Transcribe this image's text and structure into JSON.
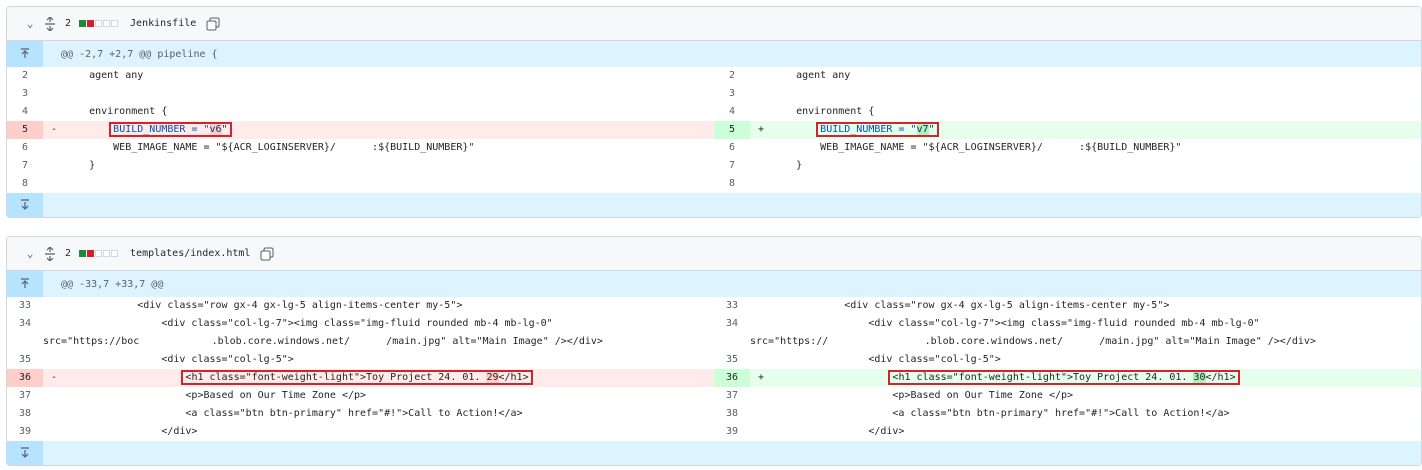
{
  "files": [
    {
      "count": "2",
      "name": "Jenkinsfile",
      "hunk": "@@ -2,7 +2,7 @@ pipeline {",
      "left": {
        "l1": {
          "n": "2",
          "t": "    agent any"
        },
        "l2": {
          "n": "3",
          "t": ""
        },
        "l3": {
          "n": "4",
          "t": "    environment {"
        },
        "l4": {
          "n": "5",
          "m": "-",
          "pre": "        ",
          "a": "BUILD_NUMBER = \"",
          "hi": "v6",
          "b": "\""
        },
        "l5": {
          "n": "6",
          "t": "        WEB_IMAGE_NAME = \"${ACR_LOGINSERVER}/      :${BUILD_NUMBER}\""
        },
        "l6": {
          "n": "7",
          "t": "    }"
        },
        "l7": {
          "n": "8",
          "t": ""
        }
      },
      "right": {
        "l1": {
          "n": "2",
          "t": "    agent any"
        },
        "l2": {
          "n": "3",
          "t": ""
        },
        "l3": {
          "n": "4",
          "t": "    environment {"
        },
        "l4": {
          "n": "5",
          "m": "+",
          "pre": "        ",
          "a": "BUILD_NUMBER = \"",
          "hi": "v7",
          "b": "\""
        },
        "l5": {
          "n": "6",
          "t": "        WEB_IMAGE_NAME = \"${ACR_LOGINSERVER}/      :${BUILD_NUMBER}\""
        },
        "l6": {
          "n": "7",
          "t": "    }"
        },
        "l7": {
          "n": "8",
          "t": ""
        }
      }
    },
    {
      "count": "2",
      "name": "templates/index.html",
      "hunk": "@@ -33,7 +33,7 @@",
      "left": {
        "l1": {
          "n": "33",
          "t": "            <div class=\"row gx-4 gx-lg-5 align-items-center my-5\">"
        },
        "l2": {
          "n": "34",
          "t": "                <div class=\"col-lg-7\"><img class=\"img-fluid rounded mb-4 mb-lg-0\""
        },
        "l2b": {
          "t": "src=\"https://boc            .blob.core.windows.net/      /main.jpg\" alt=\"Main Image\" /></div>"
        },
        "l3": {
          "n": "35",
          "t": "                <div class=\"col-lg-5\">"
        },
        "l4": {
          "n": "36",
          "m": "-",
          "pre": "                    ",
          "a": "<h1 class=\"font-weight-light\">Toy Project 24. 01. ",
          "hi": "29",
          "b": "</h1>"
        },
        "l5": {
          "n": "37",
          "t": "                    <p>Based on Our Time Zone </p>"
        },
        "l6": {
          "n": "38",
          "t": "                    <a class=\"btn btn-primary\" href=\"#!\">Call to Action!</a>"
        },
        "l7": {
          "n": "39",
          "t": "                </div>"
        }
      },
      "right": {
        "l1": {
          "n": "33",
          "t": "            <div class=\"row gx-4 gx-lg-5 align-items-center my-5\">"
        },
        "l2": {
          "n": "34",
          "t": "                <div class=\"col-lg-7\"><img class=\"img-fluid rounded mb-4 mb-lg-0\""
        },
        "l2b": {
          "t": "src=\"https://                .blob.core.windows.net/      /main.jpg\" alt=\"Main Image\" /></div>"
        },
        "l3": {
          "n": "35",
          "t": "                <div class=\"col-lg-5\">"
        },
        "l4": {
          "n": "36",
          "m": "+",
          "pre": "                    ",
          "a": "<h1 class=\"font-weight-light\">Toy Project 24. 01. ",
          "hi": "30",
          "b": "</h1>"
        },
        "l5": {
          "n": "37",
          "t": "                    <p>Based on Our Time Zone </p>"
        },
        "l6": {
          "n": "38",
          "t": "                    <a class=\"btn btn-primary\" href=\"#!\">Call to Action!</a>"
        },
        "l7": {
          "n": "39",
          "t": "                </div>"
        }
      }
    }
  ],
  "icons": {
    "chevron": "chevron-down-icon",
    "expand": "unfold-icon",
    "copy": "copy-icon",
    "expand_up": "expand-up-icon",
    "expand_down": "expand-down-icon"
  },
  "colors": {
    "hunk_bg": "#ddf4ff",
    "del_bg": "#ffebe9",
    "add_bg": "#e6ffec",
    "highlight_border": "#d1242f"
  }
}
